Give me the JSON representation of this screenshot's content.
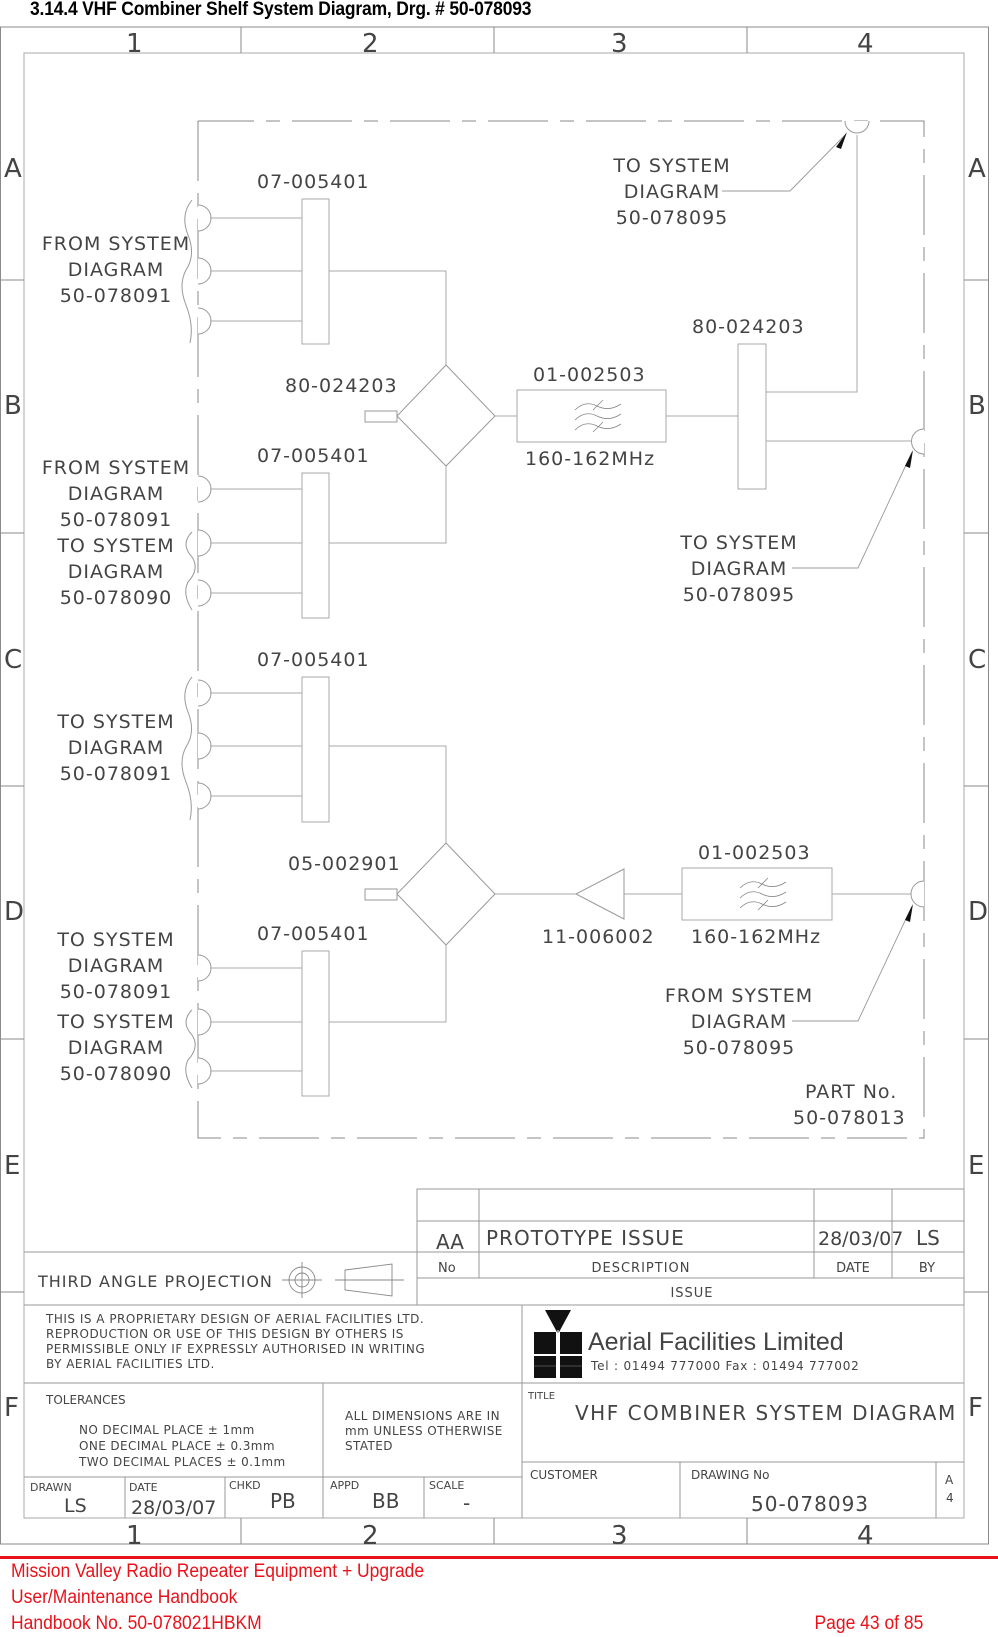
{
  "page": {
    "section_heading": "3.14.4   VHF Combiner Shelf System Diagram, Drg. # 50-078093"
  },
  "border": {
    "columns": [
      "1",
      "2",
      "3",
      "4"
    ],
    "rows": [
      "A",
      "B",
      "C",
      "D",
      "E",
      "F"
    ]
  },
  "diagram": {
    "inputs": [
      {
        "text": [
          "FROM  SYSTEM",
          "DIAGRAM",
          "50-078091"
        ]
      },
      {
        "text": [
          "FROM  SYSTEM",
          "DIAGRAM",
          "50-078091"
        ]
      },
      {
        "text": [
          "TO  SYSTEM",
          "DIAGRAM",
          "50-078090"
        ]
      },
      {
        "text": [
          "TO  SYSTEM",
          "DIAGRAM",
          "50-078091"
        ]
      },
      {
        "text": [
          "TO  SYSTEM",
          "DIAGRAM",
          "50-078091"
        ]
      },
      {
        "text": [
          "TO  SYSTEM",
          "DIAGRAM",
          "50-078090"
        ]
      }
    ],
    "splitter_labels": [
      "07-005401",
      "07-005401",
      "07-005401",
      "07-005401"
    ],
    "hybrid_top_label": "80-024203",
    "hybrid_bottom_label": "05-002901",
    "filter_top": {
      "part": "01-002503",
      "band": "160-162MHz"
    },
    "filter_bottom": {
      "part": "01-002503",
      "band": "160-162MHz"
    },
    "amplifier_label": "11-006002",
    "combiner_right_label": "80-024203",
    "callout_top": [
      "TO  SYSTEM",
      "DIAGRAM",
      "50-078095"
    ],
    "callout_middle": [
      "TO  SYSTEM",
      "DIAGRAM",
      "50-078095"
    ],
    "callout_bottom": [
      "FROM  SYSTEM",
      "DIAGRAM",
      "50-078095"
    ],
    "part_no_label": "PART  No.",
    "part_no_value": "50-078013"
  },
  "title_block": {
    "projection_label": "THIRD  ANGLE  PROJECTION",
    "issue": {
      "no": "AA",
      "description": "PROTOTYPE  ISSUE",
      "date": "28/03/07",
      "by": "LS",
      "headers": {
        "no": "No",
        "description": "DESCRIPTION",
        "date": "DATE",
        "by": "BY"
      },
      "footer_label": "ISSUE"
    },
    "proprietary_notice": [
      "THIS  IS  A  PROPRIETARY  DESIGN  OF  AERIAL  FACILITIES  LTD.",
      "REPRODUCTION  OR  USE  OF  THIS  DESIGN  BY  OTHERS  IS",
      "PERMISSIBLE  ONLY  IF  EXPRESSLY  AUTHORISED  IN  WRITING",
      "BY  AERIAL  FACILITIES  LTD."
    ],
    "company": {
      "name": "Aerial  Facilities  Limited",
      "contact": "Tel  :  01494  777000  Fax  :  01494  777002"
    },
    "tolerances": {
      "label": "TOLERANCES",
      "lines": [
        "NO  DECIMAL  PLACE  ±  1mm",
        "ONE  DECIMAL  PLACE  ±  0.3mm",
        "TWO  DECIMAL  PLACES  ±  0.1mm"
      ]
    },
    "dimensions_note": [
      "ALL  DIMENSIONS  ARE  IN",
      "mm  UNLESS  OTHERWISE",
      "STATED"
    ],
    "title_label": "TITLE",
    "title_value": "VHF  COMBINER  SYSTEM  DIAGRAM",
    "drawn_label": "DRAWN",
    "drawn_value": "LS",
    "date_label": "DATE",
    "date_value": "28/03/07",
    "chkd_label": "CHKD",
    "chkd_value": "PB",
    "appd_label": "APPD",
    "appd_value": "BB",
    "scale_label": "SCALE",
    "scale_value": "-",
    "customer_label": "CUSTOMER",
    "customer_value": "",
    "drawing_no_label": "DRAWING  No",
    "drawing_no_value": "50-078093",
    "sheet_size": [
      "A",
      "4"
    ]
  },
  "footer": {
    "line1": "Mission Valley Radio Repeater Equipment + Upgrade",
    "line2": "User/Maintenance Handbook",
    "line3": "Handbook No. 50-078021HBKM",
    "page": "Page 43 of 85"
  }
}
